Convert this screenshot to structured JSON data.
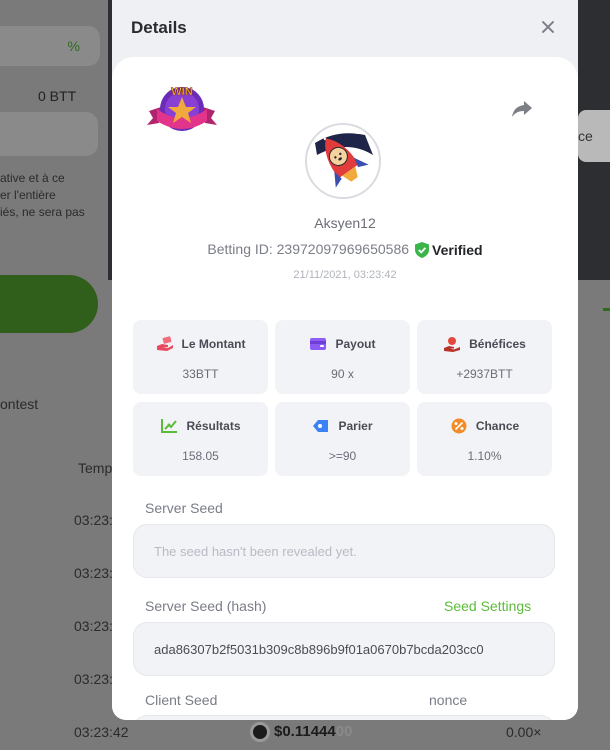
{
  "background": {
    "btt_balance": "0 BTT",
    "percent_symbol": "%",
    "paragraph_lines": [
      "ative et à ce",
      "er l'entière",
      "iés, ne sera pas"
    ],
    "contest_label": "ontest",
    "temp_header": "Temp",
    "times": [
      "03:23:",
      "03:23:",
      "03:23:",
      "03:23:"
    ],
    "right_fragment": "ce",
    "bottom_row": {
      "time": "03:23:42",
      "amount_bold": "$0.11444",
      "amount_fade": "00",
      "multiplier": "0.00×"
    }
  },
  "modal": {
    "title": "Details",
    "badge_text": "WIN",
    "username": "Aksyen12",
    "betting_id_label": "Betting ID: 23972097969650586",
    "verified_label": "Verified",
    "timestamp": "21/11/2021, 03:23:42",
    "stats": [
      {
        "label": "Le Montant",
        "value": "33BTT",
        "icon": "money-hand-icon",
        "color": "#e84a5f"
      },
      {
        "label": "Payout",
        "value": "90 x",
        "icon": "wallet-icon",
        "color": "#8b5cf6"
      },
      {
        "label": "Bénéfices",
        "value": "+2937BTT",
        "icon": "profit-coins-icon",
        "color": "#e2483c"
      },
      {
        "label": "Résultats",
        "value": "158.05",
        "icon": "results-chart-icon",
        "color": "#5cbc3a"
      },
      {
        "label": "Parier",
        "value": ">=90",
        "icon": "bet-tag-icon",
        "color": "#3b82f6"
      },
      {
        "label": "Chance",
        "value": "1.10%",
        "icon": "chance-percent-icon",
        "color": "#f28c28"
      }
    ],
    "server_seed_label": "Server Seed",
    "server_seed_placeholder": "The seed hasn't been revealed yet.",
    "server_seed_hash_label": "Server Seed (hash)",
    "seed_settings_label": "Seed Settings",
    "server_seed_hash_value": "ada86307b2f5031b309c8b896b9f01a0670b7bcda203cc0",
    "client_seed_label": "Client Seed",
    "nonce_label": "nonce"
  }
}
